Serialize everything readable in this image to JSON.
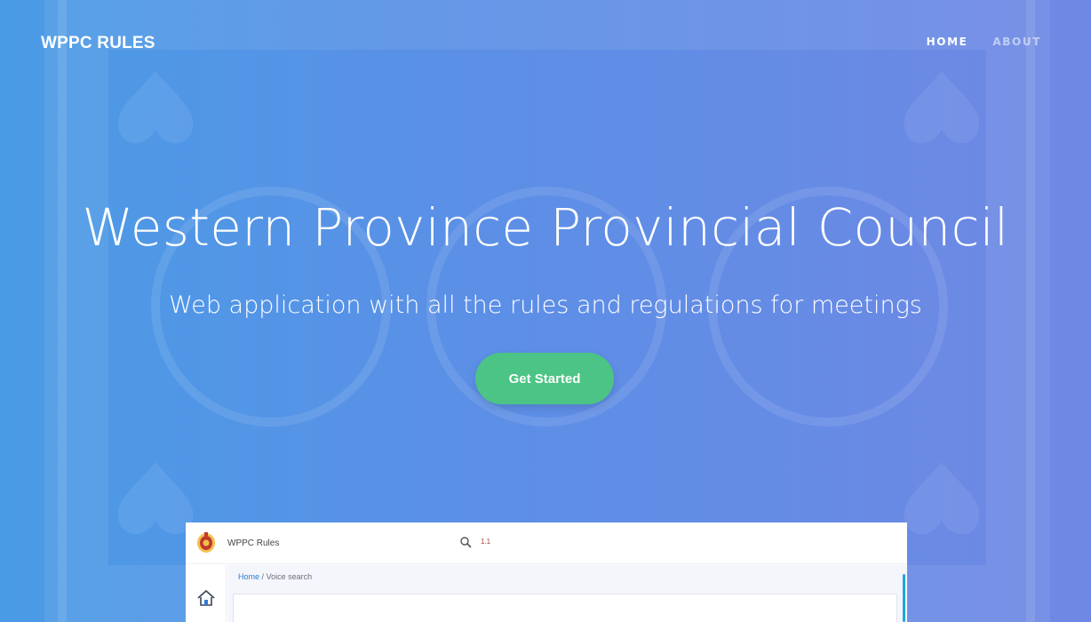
{
  "navbar": {
    "brand": "WPPC RULES",
    "links": [
      {
        "label": "HOME",
        "active": true
      },
      {
        "label": "ABOUT",
        "active": false
      }
    ]
  },
  "hero": {
    "title": "Western Province Provincial Council",
    "subtitle": "Web application with all the rules and regulations for meetings",
    "cta_label": "Get Started"
  },
  "preview": {
    "app_title": "WPPC Rules",
    "version": "1.1",
    "breadcrumb": {
      "home": "Home",
      "separator": "/",
      "current": "Voice search"
    },
    "icons": {
      "logo": "emblem-icon",
      "search": "search-icon",
      "home": "home-icon"
    }
  },
  "colors": {
    "background_start": "#4a9be6",
    "background_end": "#6f88e4",
    "cta": "#4cc485",
    "link": "#2f7bd8",
    "scrollbar": "#1ea7e1"
  }
}
